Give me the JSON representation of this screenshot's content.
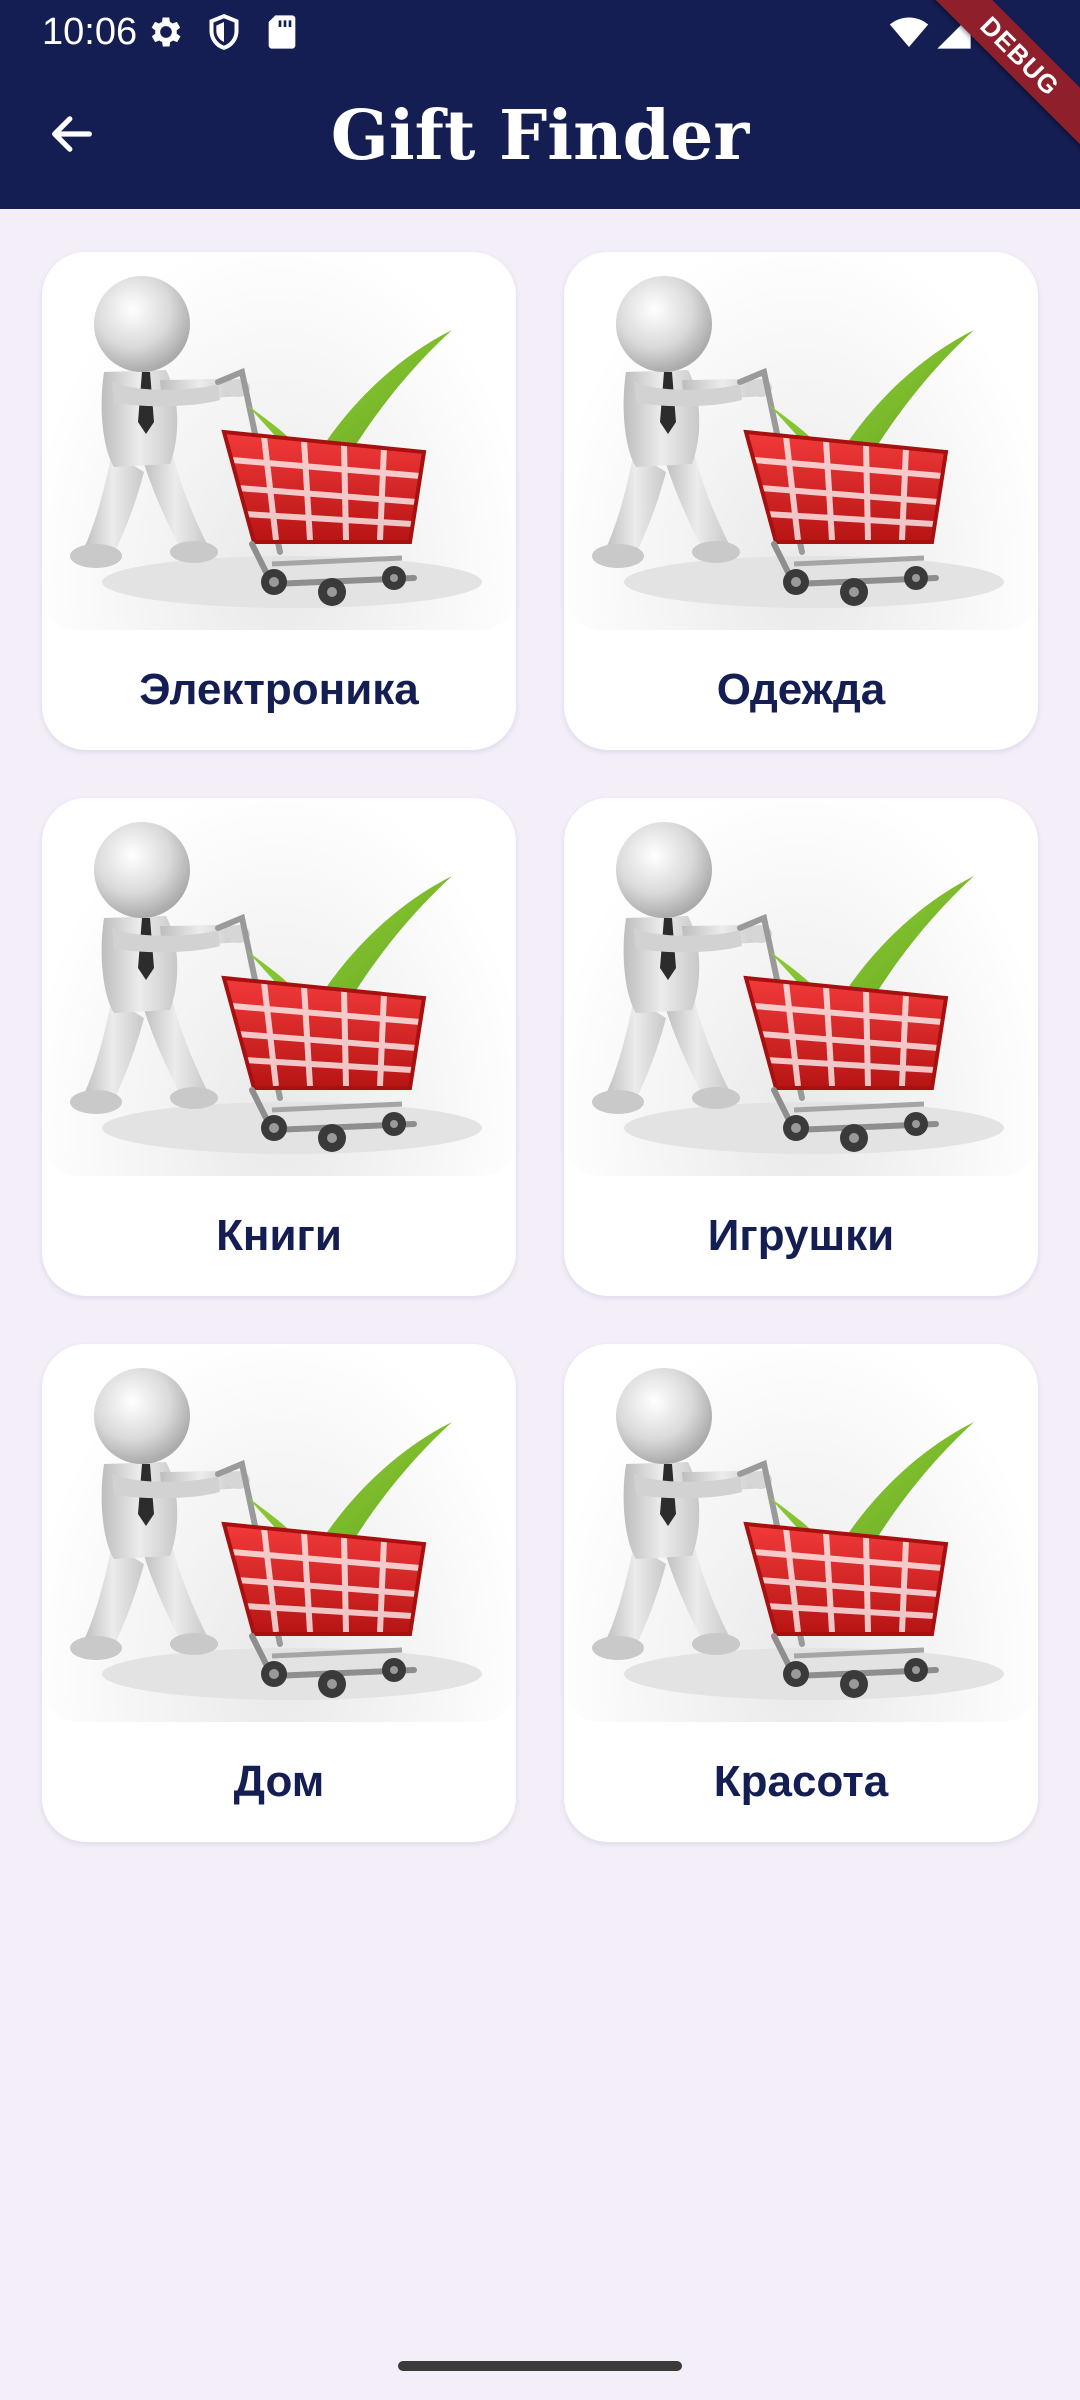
{
  "status_bar": {
    "time": "10:06",
    "left_icons": [
      "gear-icon",
      "shield-icon",
      "sd-card-icon"
    ],
    "right_icons": [
      "wifi-icon",
      "cellular-icon",
      "battery-icon"
    ]
  },
  "debug_banner": "DEBUG",
  "app_bar": {
    "title": "Gift Finder",
    "back_icon": "arrow-left-icon",
    "background_color": "#141E52"
  },
  "categories": [
    {
      "label": "Электроника",
      "image": "shopping-cart-checkmark-image"
    },
    {
      "label": "Одежда",
      "image": "shopping-cart-checkmark-image"
    },
    {
      "label": "Книги",
      "image": "shopping-cart-checkmark-image"
    },
    {
      "label": "Игрушки",
      "image": "shopping-cart-checkmark-image"
    },
    {
      "label": "Дом",
      "image": "shopping-cart-checkmark-image"
    },
    {
      "label": "Красота",
      "image": "shopping-cart-checkmark-image"
    }
  ],
  "colors": {
    "background": "#F4EEF9",
    "card": "#FFFFFF",
    "label_text": "#141E52",
    "cart_red": "#E02424",
    "check_green": "#7BC22A",
    "figure_gray": "#D7D7D7"
  }
}
